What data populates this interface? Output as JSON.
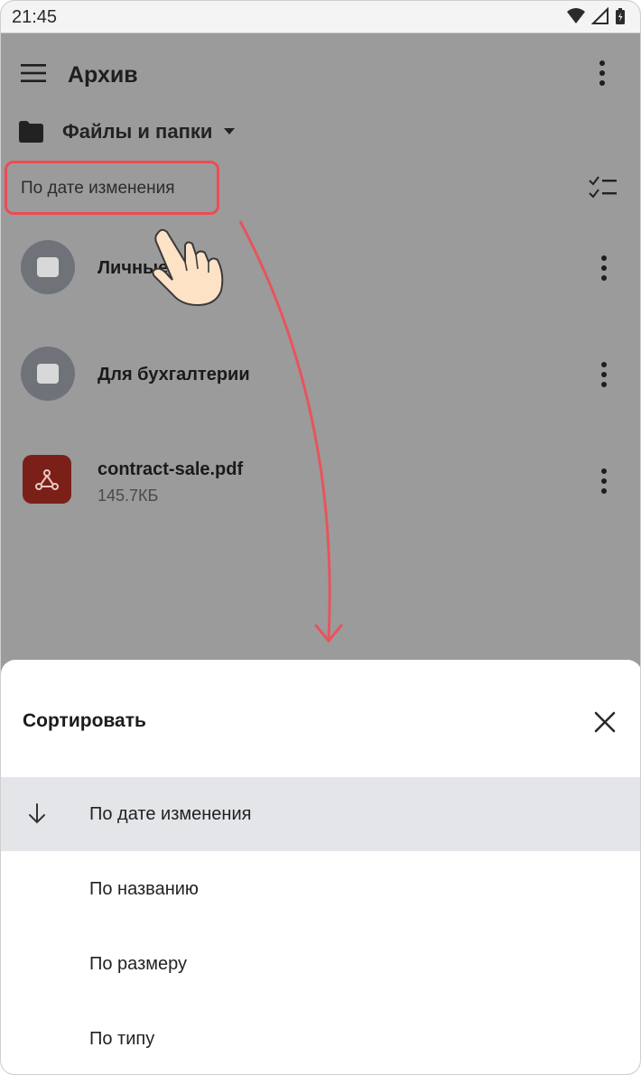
{
  "status_bar": {
    "time": "21:45",
    "icons": [
      "wifi-icon",
      "signal-icon",
      "battery-icon"
    ]
  },
  "toolbar": {
    "title": "Архив",
    "menu_icon": "hamburger-menu-icon",
    "more_icon": "more-vertical-icon"
  },
  "folder_switch": {
    "label": "Файлы и папки",
    "icon": "folder-icon",
    "caret_icon": "caret-down-icon"
  },
  "sort_chip": {
    "label": "По дате изменения"
  },
  "files": [
    {
      "name": "Личные",
      "type": "folder",
      "sub": ""
    },
    {
      "name": "Для бухгалтерии",
      "type": "folder",
      "sub": ""
    },
    {
      "name": "contract-sale.pdf",
      "type": "pdf",
      "sub": "145.7КБ"
    }
  ],
  "sheet": {
    "title": "Сортировать",
    "close_icon": "close-icon",
    "options": [
      {
        "label": "По дате изменения",
        "selected": true,
        "direction_icon": "arrow-down-icon"
      },
      {
        "label": "По названию",
        "selected": false
      },
      {
        "label": "По размеру",
        "selected": false
      },
      {
        "label": "По типу",
        "selected": false
      }
    ]
  },
  "colors": {
    "overlay": "#9b9b9b",
    "highlight_border": "#ee4b56",
    "annotation_arrow": "#e8545c",
    "selected_row": "#e4e5e9",
    "pdf_icon_bg": "#7b2018"
  }
}
